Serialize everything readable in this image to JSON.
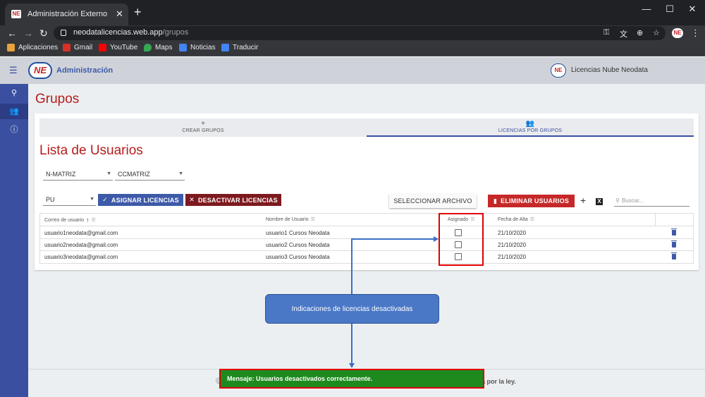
{
  "browser": {
    "tab_title": "Administración Externo",
    "tab_favicon_text": "NE",
    "url_host": "neodatalicencias.web.app",
    "url_path": "/grupos",
    "bookmarks": [
      {
        "label": "Aplicaciones",
        "icon": "apps-grid-icon",
        "color": "#e8a33d"
      },
      {
        "label": "Gmail",
        "icon": "gmail-icon",
        "color": "#d93025"
      },
      {
        "label": "YouTube",
        "icon": "youtube-icon",
        "color": "#ff0000"
      },
      {
        "label": "Maps",
        "icon": "maps-pin-icon",
        "color": "#34a853"
      },
      {
        "label": "Noticias",
        "icon": "news-icon",
        "color": "#4285f4"
      },
      {
        "label": "Traducir",
        "icon": "translate-icon",
        "color": "#4285f4"
      }
    ]
  },
  "app": {
    "title": "Administración",
    "logo_text": "NE",
    "account_label": "Licencias Nube Neodata",
    "page_title": "Grupos",
    "tabs": [
      {
        "icon": "+",
        "label": "CREAR GRUPOS",
        "active": false
      },
      {
        "icon": "people-icon",
        "label": "LICENCIAS POR GRUPOS",
        "active": true
      }
    ],
    "section_title": "Lista de Usuarios",
    "filters": {
      "matriz": "N-MATRIZ",
      "ccmatriz": "CCMATRIZ",
      "pu": "PU"
    },
    "buttons": {
      "asignar": "ASIGNAR LICENCIAS",
      "desactivar": "DESACTIVAR LICENCIAS",
      "seleccionar": "SELECCIONAR ARCHIVO",
      "eliminar": "ELIMINAR USUARIOS",
      "excel_icon": "X"
    },
    "search_placeholder": "Buscar...",
    "table": {
      "headers": {
        "correo": "Correo de usuario",
        "nombre": "Nombre de Usuario",
        "asignado": "Asignado",
        "fecha": "Fecha de Alta"
      },
      "rows": [
        {
          "correo": "usuario1neodata@gmail.com",
          "nombre": "usuario1 Cursos Neodata",
          "fecha": "21/10/2020"
        },
        {
          "correo": "usuario2neodata@gmail.com",
          "nombre": "usuario2 Cursos Neodata",
          "fecha": "21/10/2020"
        },
        {
          "correo": "usuario3neodata@gmail.com",
          "nombre": "usuario3 Cursos Neodata",
          "fecha": "21/10/2020"
        }
      ]
    },
    "footer_text": "a por la ley."
  },
  "annotation": {
    "callout": "Indicaciones de licencias desactivadas",
    "toast": "Mensaje: Usuarios desactivados correctamente."
  },
  "colors": {
    "brand_blue": "#3d5aa8",
    "brand_red": "#b71c1c",
    "toast_green": "#1e8a1e",
    "highlight_red": "#e00000"
  }
}
